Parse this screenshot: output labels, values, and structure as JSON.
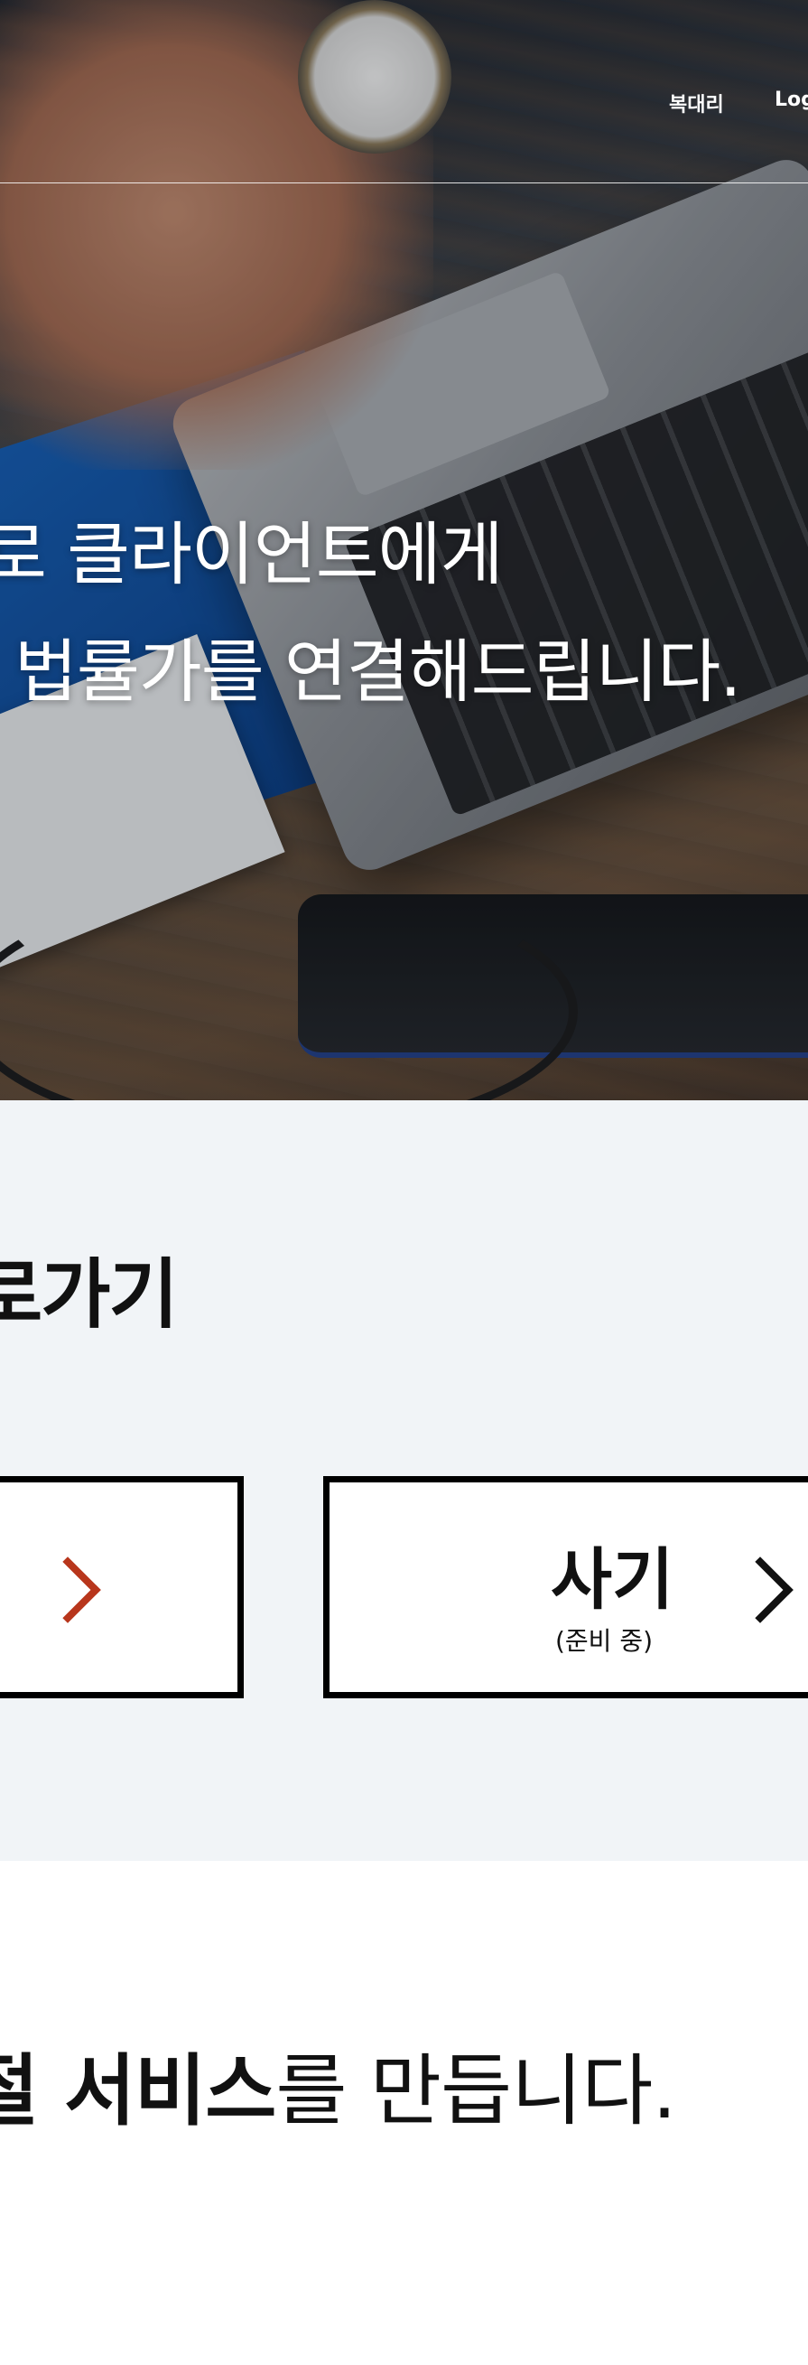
{
  "nav": {
    "items": [
      {
        "label": "복대리"
      },
      {
        "label": "Log"
      }
    ]
  },
  "hero": {
    "line1": "로 클라이언트에게",
    "line2": "법률가를 연결해드립니다."
  },
  "quick": {
    "title": "로가기",
    "left_card": {
      "label": "!"
    },
    "right_card": {
      "label": "사기",
      "sub": "(준비 중)"
    }
  },
  "service": {
    "bold": "절 서비스",
    "rest": "를 만듭니다."
  },
  "colors": {
    "accent_red": "#b8361c",
    "section_bg": "#f1f4f7",
    "text_dark": "#111111"
  }
}
